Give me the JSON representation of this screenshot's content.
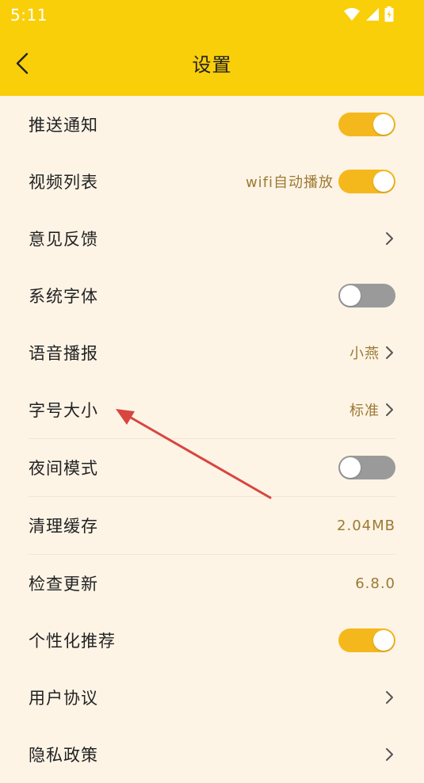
{
  "status_bar": {
    "time": "5:11"
  },
  "header": {
    "title": "设置"
  },
  "settings": [
    {
      "label": "推送通知",
      "toggle": "on"
    },
    {
      "label": "视频列表",
      "value": "wifi自动播放",
      "toggle": "on"
    },
    {
      "label": "意见反馈"
    },
    {
      "label": "系统字体",
      "toggle": "off"
    },
    {
      "label": "语音播报",
      "value": "小燕"
    },
    {
      "label": "字号大小",
      "value": "标准"
    },
    {
      "label": "夜间模式",
      "toggle": "off"
    },
    {
      "label": "清理缓存",
      "value": "2.04MB"
    },
    {
      "label": "检查更新",
      "value": "6.8.0"
    },
    {
      "label": "个性化推荐",
      "toggle": "on"
    },
    {
      "label": "用户协议"
    },
    {
      "label": "隐私政策"
    }
  ],
  "colors": {
    "header_bg": "#f9cf0a",
    "page_bg": "#fdf4e6",
    "toggle_on": "#f5b81c",
    "toggle_off": "#9a9a9a",
    "value_text": "#9c7a34",
    "annotation_arrow": "#d9453f"
  },
  "icons": {
    "back": "back-arrow-icon",
    "chevron": "chevron-right-icon",
    "wifi": "wifi-icon",
    "signal": "signal-icon",
    "battery": "battery-icon"
  }
}
